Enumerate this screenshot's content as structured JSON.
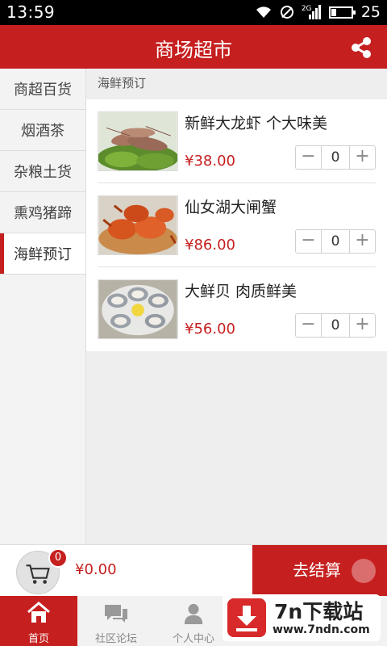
{
  "status_bar": {
    "time": "13:59",
    "network": "2G",
    "battery": "25",
    "battery_level": 0.25
  },
  "header": {
    "title": "商场超市"
  },
  "sidebar": {
    "items": [
      {
        "label": "商超百货"
      },
      {
        "label": "烟酒茶"
      },
      {
        "label": "杂粮土货"
      },
      {
        "label": "熏鸡猪蹄"
      },
      {
        "label": "海鲜预订"
      }
    ],
    "active_index": 4
  },
  "main": {
    "section_title": "海鲜预订",
    "products": [
      {
        "name": "新鲜大龙虾 个大味美",
        "price": "¥38.00",
        "qty": "0",
        "minus": "−",
        "plus": "+"
      },
      {
        "name": "仙女湖大闸蟹",
        "price": "¥86.00",
        "qty": "0",
        "minus": "−",
        "plus": "+"
      },
      {
        "name": "大鲜贝 肉质鲜美",
        "price": "¥56.00",
        "qty": "0",
        "minus": "−",
        "plus": "+"
      }
    ]
  },
  "cart": {
    "count": "0",
    "total": "¥0.00",
    "checkout_label": "去结算"
  },
  "bottom_nav": {
    "tabs": [
      {
        "label": "首页"
      },
      {
        "label": "社区论坛"
      },
      {
        "label": "个人中心"
      }
    ]
  },
  "watermark": {
    "title": "7n下载站",
    "url": "www.7ndn.com"
  },
  "colors": {
    "accent": "#c61f1f",
    "price": "#c61f1f"
  }
}
